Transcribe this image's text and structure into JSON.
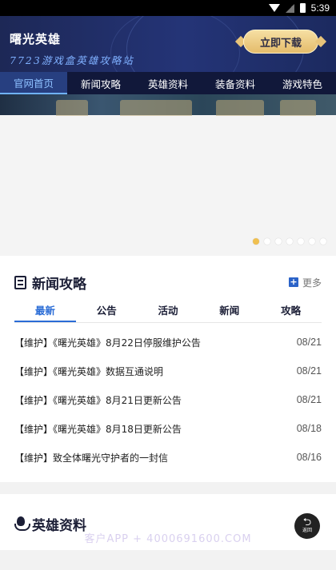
{
  "status_bar": {
    "time": "5:39",
    "icons": [
      "wifi-icon",
      "signal-icon",
      "battery-icon"
    ]
  },
  "header": {
    "title": "曙光英雄",
    "subtitle": "7723游戏盒英雄攻略站",
    "download_label": "立即下载"
  },
  "nav": {
    "tabs": [
      {
        "label": "官网首页",
        "active": true
      },
      {
        "label": "新闻攻略",
        "active": false
      },
      {
        "label": "英雄资料",
        "active": false
      },
      {
        "label": "装备资料",
        "active": false
      },
      {
        "label": "游戏特色",
        "active": false
      }
    ]
  },
  "banner": {
    "slide_count": 7,
    "active_slide": 1
  },
  "news": {
    "title": "新闻攻略",
    "more_label": "更多",
    "tabs": [
      {
        "label": "最新",
        "active": true
      },
      {
        "label": "公告",
        "active": false
      },
      {
        "label": "活动",
        "active": false
      },
      {
        "label": "新闻",
        "active": false
      },
      {
        "label": "攻略",
        "active": false
      }
    ],
    "items": [
      {
        "title": "【维护】《曙光英雄》8月22日停服维护公告",
        "date": "08/21"
      },
      {
        "title": "【维护】《曙光英雄》数据互通说明",
        "date": "08/21"
      },
      {
        "title": "【维护】《曙光英雄》8月21日更新公告",
        "date": "08/21"
      },
      {
        "title": "【维护】《曙光英雄》8月18日更新公告",
        "date": "08/18"
      },
      {
        "title": "【维护】致全体曙光守护者的一封信",
        "date": "08/16"
      }
    ]
  },
  "heroes": {
    "title": "英雄资料"
  },
  "watermark": "客户APP + 4000691600.COM",
  "back_button": {
    "label": "返回"
  },
  "colors": {
    "accent": "#2a6cd6",
    "header_bg": "#1d2856",
    "gold": "#e4bc6b",
    "active_dot": "#f0c050"
  }
}
